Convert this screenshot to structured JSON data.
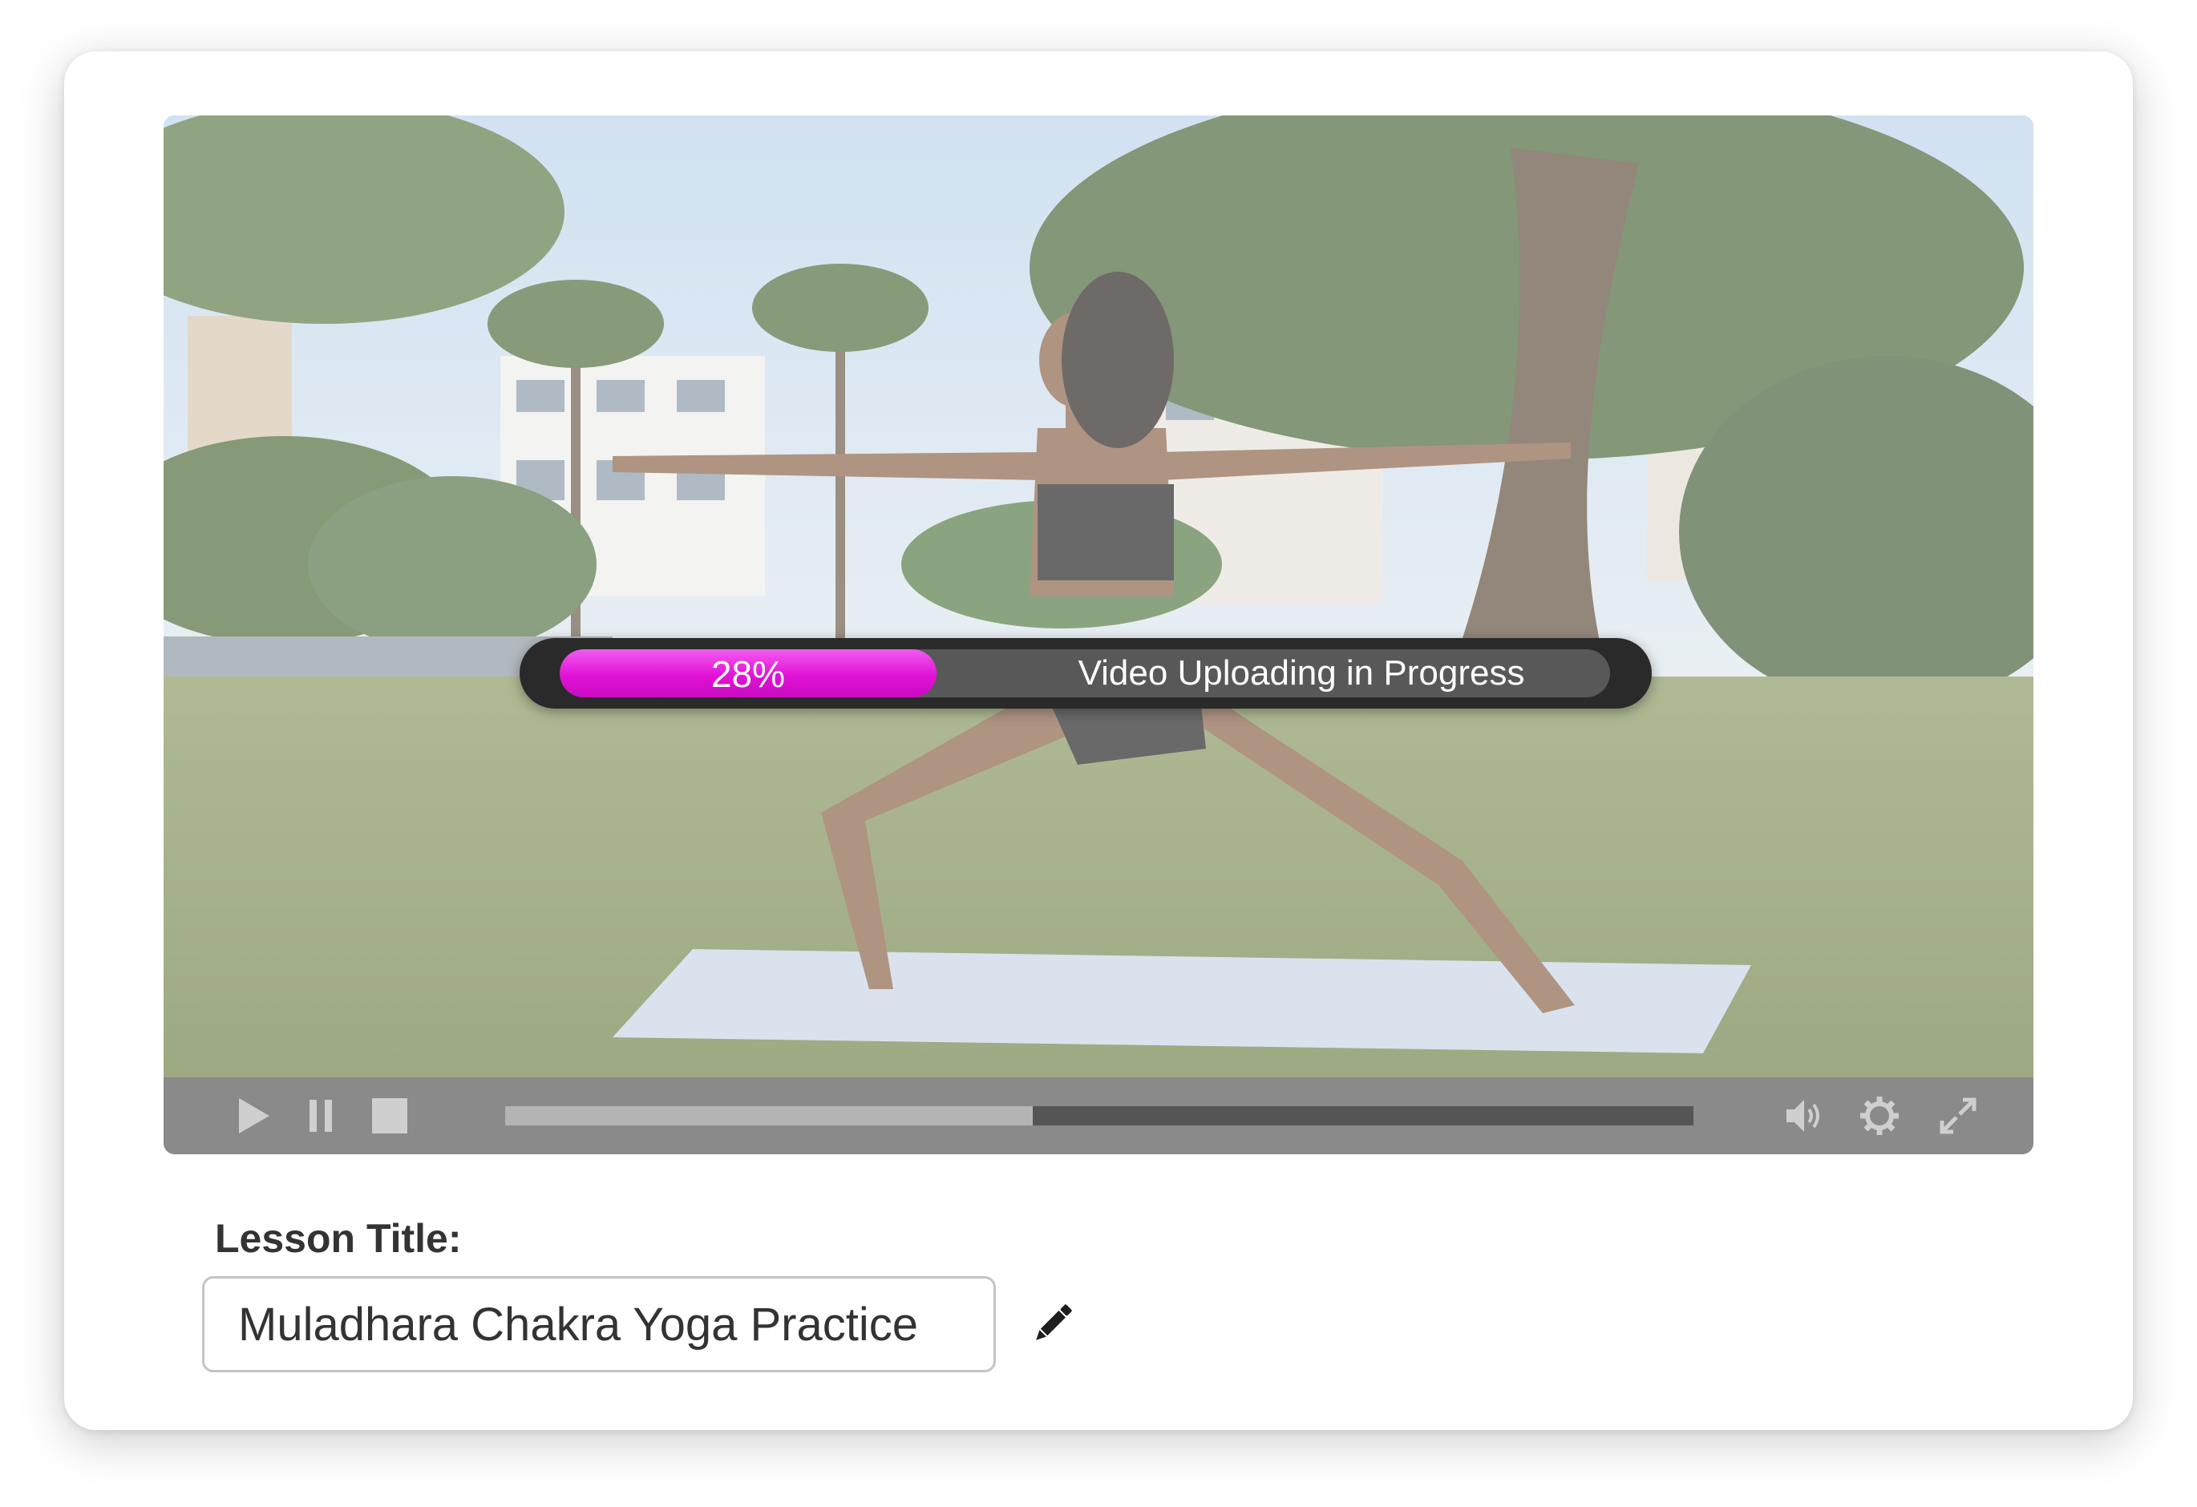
{
  "upload": {
    "percent_label": "28%",
    "progress_fraction": 0.28,
    "message": "Video Uploading in Progress",
    "fill_color": "#e012d6"
  },
  "player": {
    "playback_fraction": 0.444,
    "controls": [
      "play-icon",
      "pause-icon",
      "stop-icon",
      "volume-icon",
      "settings-icon",
      "fullscreen-icon"
    ]
  },
  "lesson": {
    "label": "Lesson Title:",
    "title_value": "Muladhara Chakra Yoga Practice",
    "edit_icon": "pencil-icon"
  }
}
